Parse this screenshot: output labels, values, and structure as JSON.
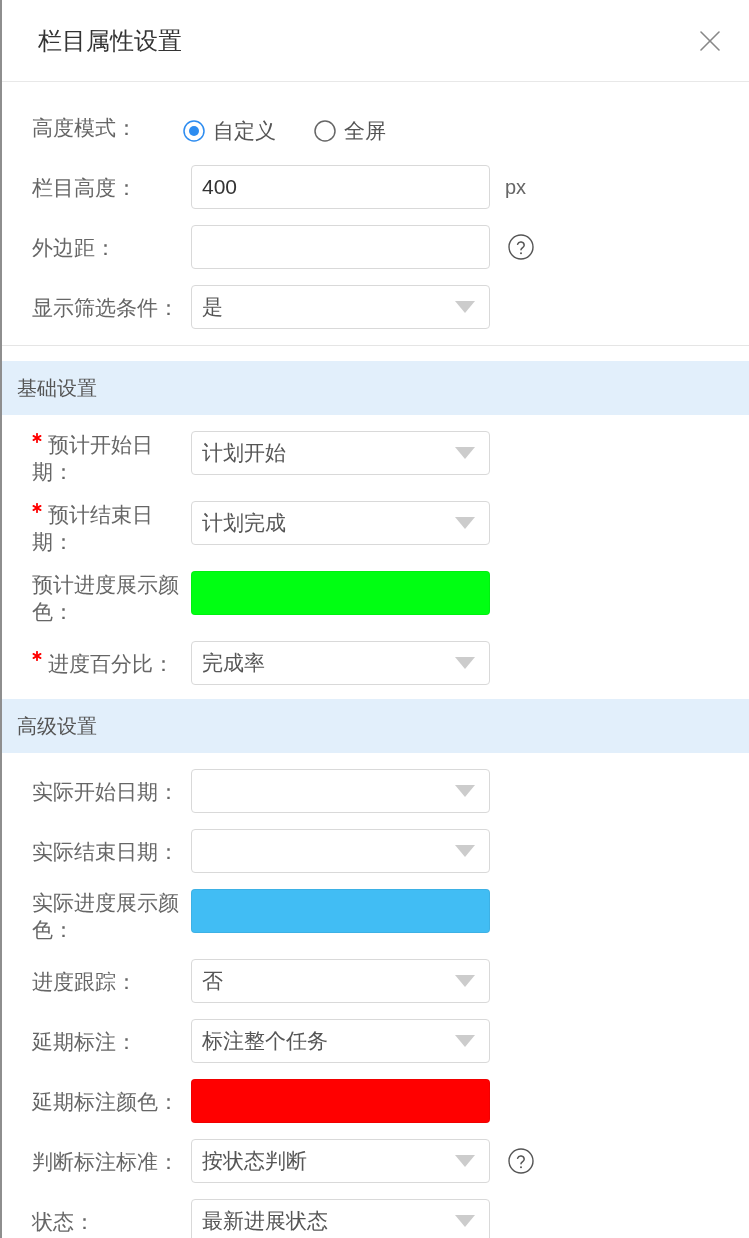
{
  "drawer": {
    "title": "栏目属性设置"
  },
  "general": [
    {
      "kind": "radio",
      "label": "高度模式：",
      "required": false,
      "help": false,
      "options": [
        {
          "label": "自定义",
          "selected": true
        },
        {
          "label": "全屏",
          "selected": false
        }
      ]
    },
    {
      "kind": "input",
      "label": "栏目高度：",
      "required": false,
      "help": false,
      "value": "400",
      "unit": "px"
    },
    {
      "kind": "input",
      "label": "外边距：",
      "required": false,
      "help": true
    },
    {
      "kind": "select",
      "label": "显示筛选条件：",
      "required": false,
      "help": false,
      "value": "是"
    }
  ],
  "sections": [
    {
      "title": "基础设置",
      "fields": [
        {
          "kind": "select",
          "label": "预计开始日期：",
          "required": true,
          "help": false,
          "value": "计划开始"
        },
        {
          "kind": "select",
          "label": "预计结束日期：",
          "required": true,
          "help": false,
          "value": "计划完成"
        },
        {
          "kind": "color",
          "label": "预计进度展示颜色：",
          "required": false,
          "help": false,
          "color": "#00ff12"
        },
        {
          "kind": "select",
          "label": "进度百分比：",
          "required": true,
          "help": false,
          "value": "完成率"
        }
      ]
    },
    {
      "title": "高级设置",
      "fields": [
        {
          "kind": "select",
          "label": "实际开始日期：",
          "required": false,
          "help": false
        },
        {
          "kind": "select",
          "label": "实际结束日期：",
          "required": false,
          "help": false
        },
        {
          "kind": "color",
          "label": "实际进度展示颜色：",
          "required": false,
          "help": false,
          "color": "#41bdf4"
        },
        {
          "kind": "select",
          "label": "进度跟踪：",
          "required": false,
          "help": false,
          "value": "否"
        },
        {
          "kind": "select",
          "label": "延期标注：",
          "required": false,
          "help": false,
          "value": "标注整个任务"
        },
        {
          "kind": "color",
          "label": "延期标注颜色：",
          "required": false,
          "help": false,
          "color": "#ff0000"
        },
        {
          "kind": "select",
          "label": "判断标注标准：",
          "required": false,
          "help": true,
          "value": "按状态判断"
        },
        {
          "kind": "select",
          "label": "状态：",
          "required": false,
          "help": false,
          "value": "最新进展状态"
        }
      ]
    }
  ]
}
